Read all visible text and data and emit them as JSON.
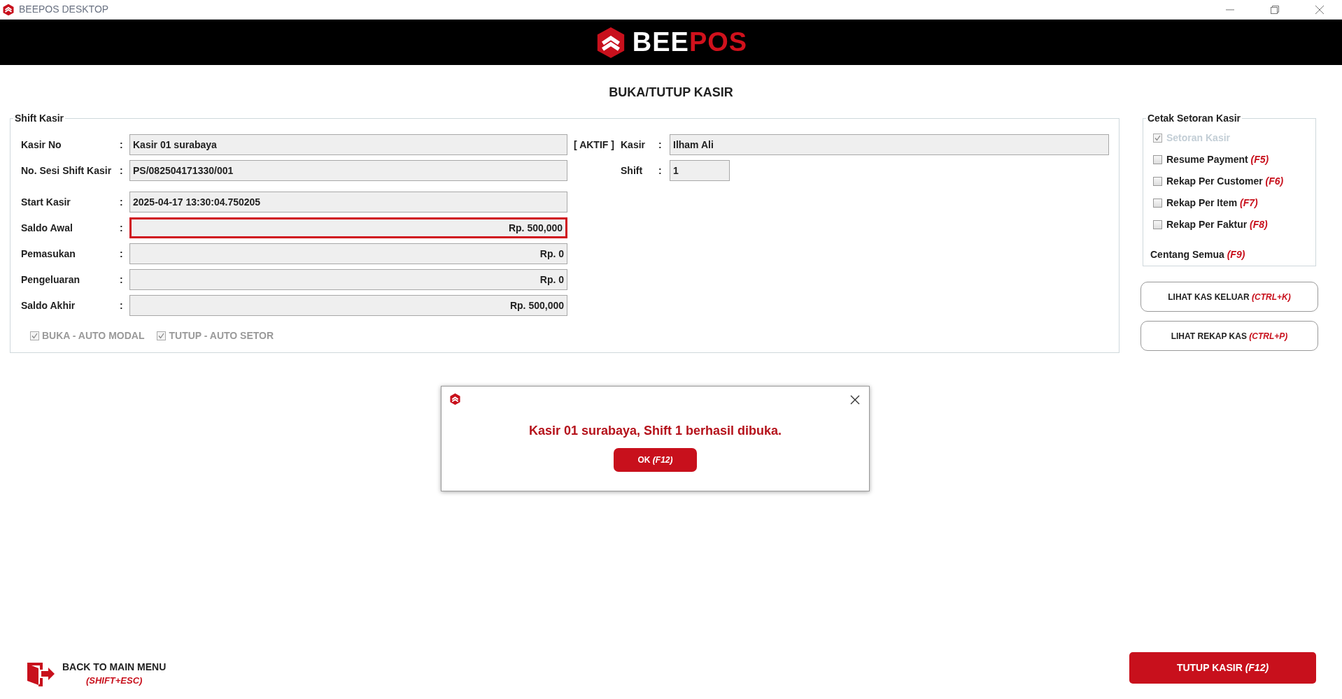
{
  "window": {
    "title": "BEEPOS DESKTOP"
  },
  "brand": [
    {
      "text": "BEE",
      "color": "#ffffff"
    },
    {
      "text": "POS",
      "color": "#d0111c"
    }
  ],
  "page_title": "BUKA/TUTUP KASIR",
  "shift_kasir": {
    "legend": "Shift Kasir",
    "status": "[ AKTIF ]",
    "fields": [
      {
        "label": "Kasir No",
        "separator": ":",
        "value": "Kasir 01 surabaya",
        "right_aligned": false,
        "highlighted": false
      },
      {
        "label": "No. Sesi Shift Kasir",
        "separator": ":",
        "value": "PS/082504171330/001",
        "right_aligned": false,
        "highlighted": false
      },
      {
        "label": "Start Kasir",
        "separator": ":",
        "value": "2025-04-17 13:30:04.750205",
        "right_aligned": false,
        "highlighted": false
      },
      {
        "label": "Saldo Awal",
        "separator": ":",
        "value": "Rp. 500,000",
        "right_aligned": true,
        "highlighted": true
      },
      {
        "label": "Pemasukan",
        "separator": ":",
        "value": "Rp. 0",
        "right_aligned": true,
        "highlighted": false
      },
      {
        "label": "Pengeluaran",
        "separator": ":",
        "value": "Rp. 0",
        "right_aligned": true,
        "highlighted": false
      },
      {
        "label": "Saldo Akhir",
        "separator": ":",
        "value": "Rp. 500,000",
        "right_aligned": true,
        "highlighted": false
      }
    ],
    "side_fields": [
      {
        "label": "Kasir",
        "separator": ":",
        "value": "Ilham Ali",
        "wide": true
      },
      {
        "label": "Shift",
        "separator": ":",
        "value": "1",
        "wide": false
      }
    ],
    "options": [
      {
        "label": "BUKA - AUTO MODAL",
        "checked": true,
        "disabled": true
      },
      {
        "label": "TUTUP - AUTO SETOR",
        "checked": true,
        "disabled": true
      }
    ]
  },
  "cetak_setoran": {
    "legend": "Cetak Setoran Kasir",
    "items": [
      {
        "label": "Setoran Kasir",
        "checked": true,
        "disabled": true
      },
      {
        "label": "Resume Payment",
        "shortcut": "(F5)",
        "checked": false,
        "disabled": false
      },
      {
        "label": "Rekap Per Customer",
        "shortcut": "(F6)",
        "checked": false,
        "disabled": false
      },
      {
        "label": "Rekap Per Item",
        "shortcut": "(F7)",
        "checked": false,
        "disabled": false
      },
      {
        "label": "Rekap Per Faktur",
        "shortcut": "(F8)",
        "checked": false,
        "disabled": false
      }
    ],
    "check_all": {
      "label": "Centang Semua",
      "shortcut": "(F9)"
    }
  },
  "side_buttons": [
    {
      "label": "LIHAT KAS KELUAR",
      "shortcut": "(CTRL+K)"
    },
    {
      "label": "LIHAT REKAP KAS",
      "shortcut": "(CTRL+P)"
    }
  ],
  "dialog": {
    "message": "Kasir 01 surabaya, Shift 1 berhasil dibuka.",
    "button": {
      "label": "OK",
      "shortcut": "(F12)"
    }
  },
  "back": {
    "label": "BACK TO MAIN MENU",
    "shortcut": "(SHIFT+ESC)"
  },
  "close_button": {
    "label": "TUTUP KASIR",
    "shortcut": "(F12)"
  }
}
